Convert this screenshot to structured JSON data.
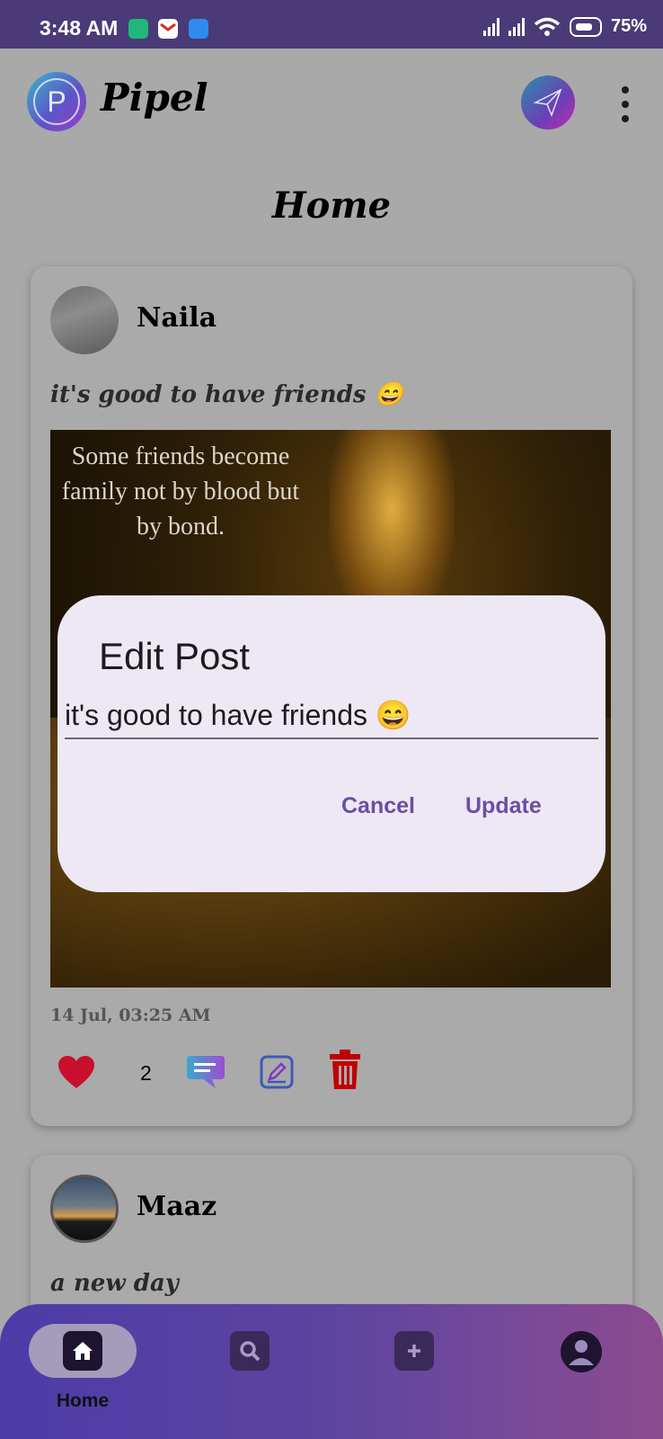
{
  "status_bar": {
    "time": "3:48 AM",
    "battery": "75%"
  },
  "app_bar": {
    "logo_letter": "P",
    "app_name": "Pipel"
  },
  "page": {
    "title": "Home"
  },
  "posts": [
    {
      "author": "Naila",
      "caption": "it's good to have friends 😄",
      "image_quote": "Some friends become family not by blood but by bond.",
      "timestamp": "14 Jul, 03:25 AM",
      "likes": "2"
    },
    {
      "author": "Maaz",
      "caption": "a new day"
    }
  ],
  "dialog": {
    "title": "Edit Post",
    "input_value": "it's good to have friends 😄",
    "cancel_label": "Cancel",
    "update_label": "Update"
  },
  "bottom_nav": {
    "home_label": "Home",
    "active": "home"
  },
  "colors": {
    "status_bar": "#4a3a77",
    "dialog_bg": "#eee8f4",
    "dialog_button": "#6750a4",
    "like": "#c8102e",
    "delete": "#c00000",
    "nav_gradient_start": "#4d3ca8",
    "nav_gradient_end": "#8c4a8f"
  },
  "icons": [
    "whatsapp-notification-icon",
    "gmail-notification-icon",
    "messenger-notification-icon",
    "signal-icon",
    "wifi-icon",
    "battery-icon",
    "send-icon",
    "more-vert-icon",
    "heart-icon",
    "comment-icon",
    "edit-icon",
    "trash-icon",
    "home-icon",
    "search-icon",
    "add-icon",
    "profile-icon"
  ]
}
